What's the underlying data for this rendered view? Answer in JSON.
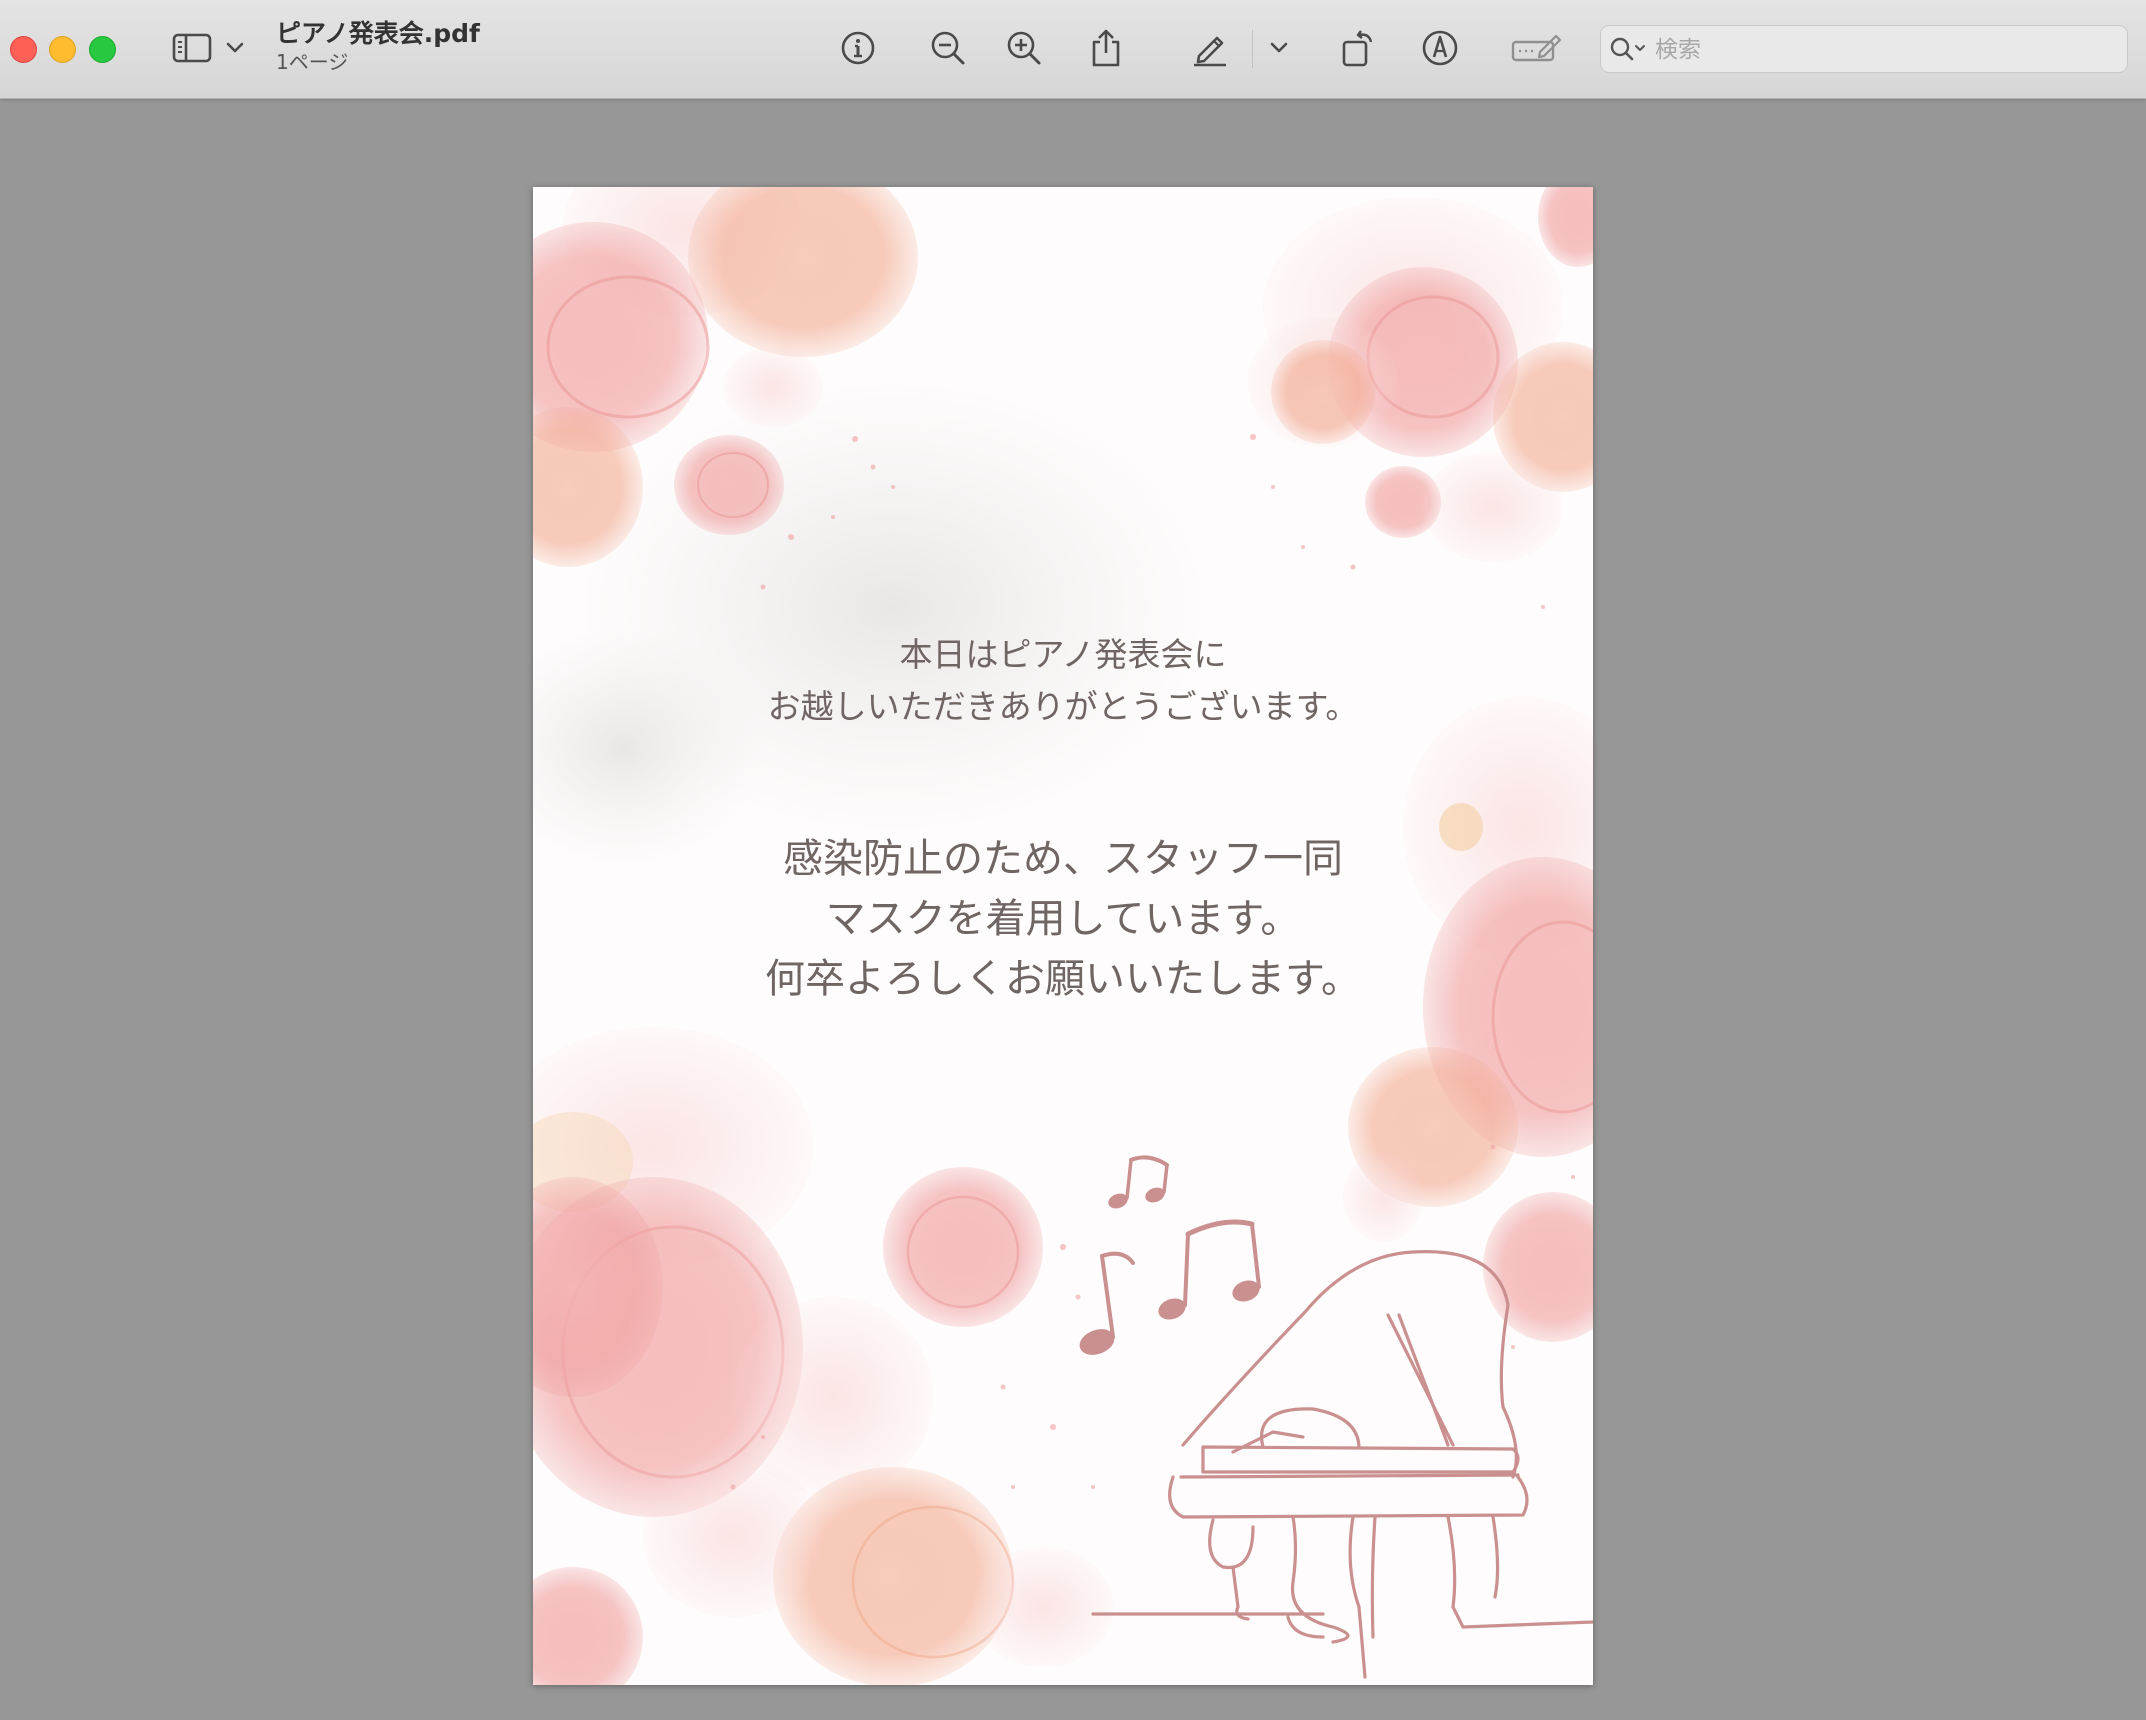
{
  "window": {
    "title": "ピアノ発表会.pdf",
    "subtitle": "1ページ"
  },
  "toolbar": {
    "buttons": [
      {
        "name": "sidebar-toggle",
        "icon": "sidebar-icon"
      },
      {
        "name": "sidebar-menu",
        "icon": "chevron-down-icon"
      },
      {
        "name": "info",
        "icon": "info-icon"
      },
      {
        "name": "zoom-out",
        "icon": "zoom-out-icon"
      },
      {
        "name": "zoom-in",
        "icon": "zoom-in-icon"
      },
      {
        "name": "share",
        "icon": "share-icon"
      },
      {
        "name": "markup",
        "icon": "pencil-icon"
      },
      {
        "name": "markup-menu",
        "icon": "chevron-down-icon"
      },
      {
        "name": "rotate",
        "icon": "rotate-icon"
      },
      {
        "name": "annotate",
        "icon": "pen-circle-icon"
      },
      {
        "name": "form-fill",
        "icon": "form-icon"
      }
    ],
    "search": {
      "placeholder": "検索",
      "value": ""
    }
  },
  "document": {
    "message1": [
      "本日はピアノ発表会に",
      "お越しいただきありがとうございます。"
    ],
    "message2": [
      "感染防止のため、スタッフ一同",
      "マスクを着用しています。",
      "何卒よろしくお願いいたします。"
    ]
  },
  "colors": {
    "canvas": "#979797",
    "text": "#6f6563",
    "piano_line": "#c9908f",
    "petal": "#f1a6a6"
  }
}
